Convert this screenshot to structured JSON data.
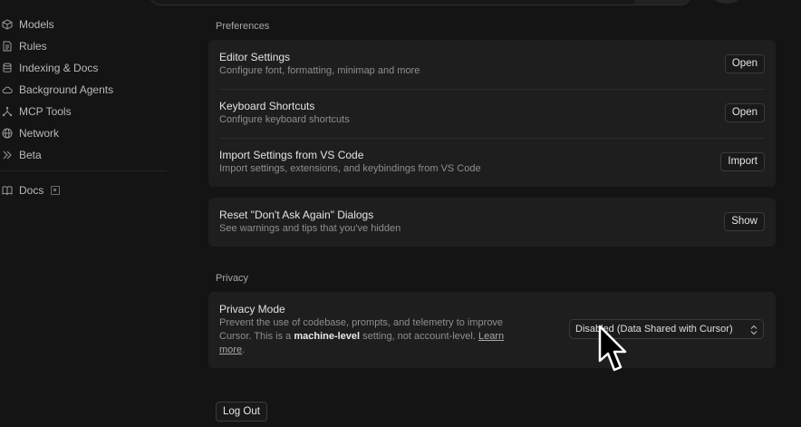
{
  "sidebar": {
    "items": [
      {
        "label": "Models",
        "icon": "cube-icon"
      },
      {
        "label": "Rules",
        "icon": "document-icon"
      },
      {
        "label": "Indexing & Docs",
        "icon": "database-icon"
      },
      {
        "label": "Background Agents",
        "icon": "cloud-icon"
      },
      {
        "label": "MCP Tools",
        "icon": "nodes-icon"
      },
      {
        "label": "Network",
        "icon": "globe-icon"
      },
      {
        "label": "Beta",
        "icon": "chevrons-right-icon"
      }
    ],
    "docs": {
      "label": "Docs",
      "icon": "book-icon",
      "badge_icon": "external-link-icon"
    }
  },
  "preferences": {
    "label": "Preferences",
    "rows": [
      {
        "title": "Editor Settings",
        "desc": "Configure font, formatting, minimap and more",
        "button": "Open"
      },
      {
        "title": "Keyboard Shortcuts",
        "desc": "Configure keyboard shortcuts",
        "button": "Open"
      },
      {
        "title": "Import Settings from VS Code",
        "desc": "Import settings, extensions, and keybindings from VS Code",
        "button": "Import"
      }
    ]
  },
  "reset": {
    "title": "Reset \"Don't Ask Again\" Dialogs",
    "desc": "See warnings and tips that you've hidden",
    "button": "Show"
  },
  "privacy": {
    "label": "Privacy",
    "title": "Privacy Mode",
    "desc_line1": "Prevent the use of codebase, prompts, and telemetry to improve",
    "desc_pre": "Cursor. This is a ",
    "desc_bold": "machine-level",
    "desc_mid": " setting, not account-level. ",
    "desc_link1": "Learn",
    "desc_link2": "more",
    "desc_end": ".",
    "select_value": "Disabled (Data Shared with Cursor)"
  },
  "logout": {
    "label": "Log Out"
  }
}
